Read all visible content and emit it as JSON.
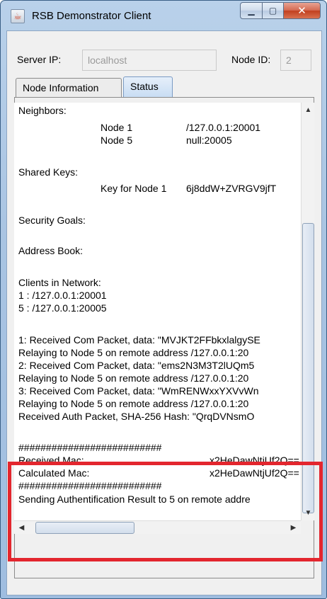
{
  "window": {
    "title": "RSB Demonstrator Client"
  },
  "header": {
    "server_ip_label": "Server IP:",
    "server_ip_value": "localhost",
    "node_id_label": "Node ID:",
    "node_id_value": "2"
  },
  "tabs": [
    {
      "label": "Node Information",
      "active": false
    },
    {
      "label": "Status",
      "active": true
    }
  ],
  "status": {
    "neighbors_heading": "Neighbors:",
    "neighbors": [
      {
        "node": "Node 1",
        "address": "/127.0.0.1:20001"
      },
      {
        "node": "Node 5",
        "address": "null:20005"
      }
    ],
    "shared_keys_heading": "Shared Keys:",
    "shared_key": {
      "name": "Key for Node 1",
      "value": "6j8ddW+ZVRGV9jfT"
    },
    "security_goals_heading": "Security Goals:",
    "address_book_heading": "Address Book:",
    "clients_heading": "Clients in Network:",
    "clients": [
      "1 : /127.0.0.1:20001",
      "5 : /127.0.0.1:20005"
    ],
    "log": [
      "1: Received Com Packet, data: \"MVJKT2FFbkxlalgySE",
      "Relaying to Node 5 on remote address /127.0.0.1:20",
      "2: Received Com Packet, data: \"ems2N3M3T2lUQm5",
      "Relaying to Node 5 on remote address /127.0.0.1:20",
      "3: Received Com Packet, data: \"WmRENWxxYXVvWn",
      "Relaying to Node 5 on remote address /127.0.0.1:20",
      "Received Auth Packet, SHA-256 Hash: \"QrqDVNsmO"
    ],
    "separator": "##########################",
    "received_mac_label": "Received Mac:",
    "received_mac_value": "x2HeDawNtjUf2Q==",
    "calculated_mac_label": "Calculated Mac:",
    "calculated_mac_value": "x2HeDawNtjUf2Q==",
    "final_line": "Sending Authentification Result to 5 on remote addre"
  },
  "colors": {
    "highlight": "#e3262e",
    "title_bar": "#b9d1ea"
  },
  "icons": {
    "app": "java-app-icon",
    "minimize": "minimize-icon",
    "maximize": "maximize-icon",
    "close": "close-icon"
  }
}
